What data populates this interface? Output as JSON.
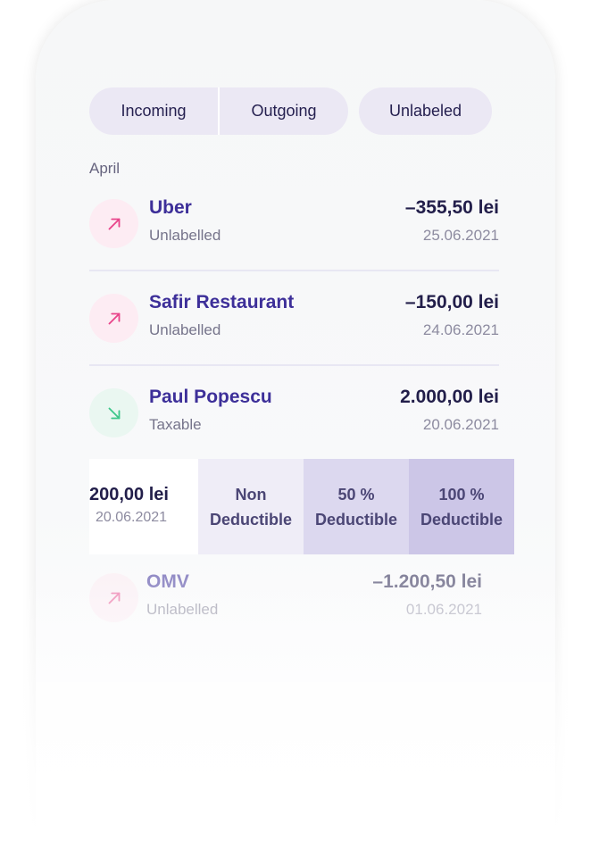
{
  "filters": {
    "incoming": "Incoming",
    "outgoing": "Outgoing",
    "unlabeled": "Unlabeled"
  },
  "month": "April",
  "transactions": [
    {
      "name": "Uber",
      "label": "Unlabelled",
      "amount": "–355,50 lei",
      "date": "25.06.2021",
      "direction": "outgoing"
    },
    {
      "name": "Safir Restaurant",
      "label": "Unlabelled",
      "amount": "–150,00 lei",
      "date": "24.06.2021",
      "direction": "outgoing"
    },
    {
      "name": "Paul Popescu",
      "label": "Taxable",
      "amount": "2.000,00 lei",
      "date": "20.06.2021",
      "direction": "incoming"
    },
    {
      "name": "OMV",
      "label": "Unlabelled",
      "amount": "–1.200,50 lei",
      "date": "01.06.2021",
      "direction": "outgoing"
    }
  ],
  "swipe": {
    "amount": "200,00 lei",
    "date": "20.06.2021",
    "actions": [
      {
        "line1": "Non",
        "line2": "Deductible"
      },
      {
        "line1": "50 %",
        "line2": "Deductible"
      },
      {
        "line1": "100 %",
        "line2": "Deductible"
      }
    ]
  },
  "colors": {
    "accent": "#3d2f99",
    "outgoing_icon": "#e8448a",
    "incoming_icon": "#3cc68a"
  },
  "icons": {
    "outgoing": "arrow-up-right-icon",
    "incoming": "arrow-down-right-icon"
  }
}
